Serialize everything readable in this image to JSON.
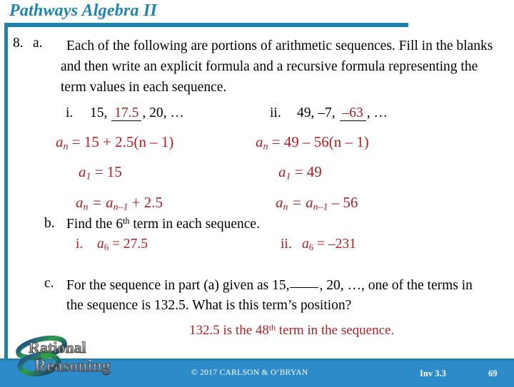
{
  "header": {
    "title": "Pathways Algebra II",
    "title_color": "#2083ad",
    "rule_color": "#1e82ab"
  },
  "problem": {
    "number": "8.",
    "part_a": {
      "label": "a.",
      "text": "Each of the following are portions of arithmetic sequences. Fill in the blanks and then write an explicit formula and a recursive formula representing the term values in each sequence.",
      "sequences": [
        {
          "roman": "i.",
          "prefix": "15,",
          "blank_answer": "17.5",
          "suffix": ", 20, …"
        },
        {
          "roman": "ii.",
          "prefix": "49, –7,",
          "blank_answer": "–63",
          "suffix": ", …"
        }
      ],
      "formulas": {
        "left": {
          "explicit_lhs": "a",
          "explicit_sub": "n",
          "explicit_rhs": "= 15 + 2.5(n – 1)",
          "first_term_lhs": "a",
          "first_term_sub": "1",
          "first_term_rhs": "= 15",
          "recursive_lhs": "a",
          "recursive_sub": "n",
          "recursive_mid": "= a",
          "recursive_mid_sub": "n–1",
          "recursive_rhs": "+ 2.5"
        },
        "right": {
          "explicit_lhs": "a",
          "explicit_sub": "n",
          "explicit_rhs": "= 49 – 56(n – 1)",
          "first_term_lhs": "a",
          "first_term_sub": "1",
          "first_term_rhs": "= 49",
          "recursive_lhs": "a",
          "recursive_sub": "n",
          "recursive_mid": "= a",
          "recursive_mid_sub": "n–1",
          "recursive_rhs": "– 56"
        }
      }
    },
    "part_b": {
      "label": "b.",
      "text_before_sup": "Find the 6",
      "text_sup": "th",
      "text_after_sup": " term in each sequence.",
      "answers": [
        {
          "roman": "i.",
          "var": "a",
          "sub": "6",
          "value": "= 27.5"
        },
        {
          "roman": "ii.",
          "var": "a",
          "sub": "6",
          "value": "= –231"
        }
      ]
    },
    "part_c": {
      "label": "c.",
      "text_part1": "For the sequence in part (a) given as 15,",
      "text_part2": ", 20, …, one of the terms in the sequence is 132.5. What is this term’s position?",
      "answer_before_sup": "132.5 is the 48",
      "answer_sup": "th",
      "answer_after_sup": " term in the sequence."
    }
  },
  "logo": {
    "line1": "Rational",
    "line2": "Reasoning",
    "swoosh_colors": [
      "#2f9e46",
      "#1b3fa0"
    ]
  },
  "footer": {
    "copyright": "© 2017 CARLSON & O’BRYAN",
    "investigation": "Inv 3.3",
    "page_number": "69",
    "bg_color": "#2e8bc9"
  },
  "colors": {
    "answer_red": "#b01f24",
    "teal": "#1e82ab",
    "body_text": "#000000"
  }
}
